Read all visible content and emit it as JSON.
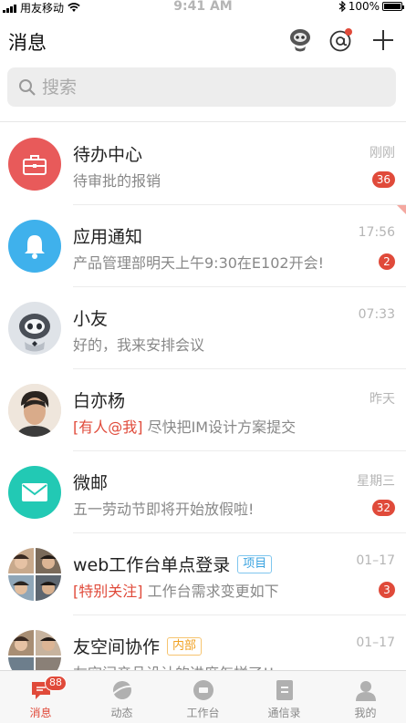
{
  "status_bar": {
    "carrier": "用友移动",
    "time": "9:41 AM",
    "battery": "100%"
  },
  "header": {
    "title": "消息"
  },
  "search": {
    "placeholder": "搜索"
  },
  "conversations": [
    {
      "name": "待办中心",
      "preview": "待审批的报销",
      "time": "刚刚",
      "badge": "36",
      "avatar": "briefcase-icon",
      "color": "#e85a5a"
    },
    {
      "name": "应用通知",
      "preview": "产品管理部明天上午9:30在E102开会!",
      "time": "17:56",
      "badge": "2",
      "avatar": "bell-icon",
      "color": "#3fb1ec"
    },
    {
      "name": "小友",
      "preview": "好的，我来安排会议",
      "time": "07:33",
      "badge": "",
      "avatar": "robot-avatar"
    },
    {
      "name": "白亦杨",
      "highlight": "[有人@我]",
      "preview": " 尽快把IM设计方案提交",
      "time": "昨天",
      "badge": "",
      "avatar": "user-photo"
    },
    {
      "name": "微邮",
      "preview": "五一劳动节即将开始放假啦!",
      "time": "星期三",
      "badge": "32",
      "avatar": "mail-icon",
      "color": "#22c9b4"
    },
    {
      "name": "web工作台单点登录",
      "tag": "项目",
      "highlight": "[特别关注]",
      "preview": " 工作台需求变更如下",
      "time": "01–17",
      "badge": "3",
      "avatar": "group-photo"
    },
    {
      "name": "友空间协作",
      "tag": "内部",
      "preview": "友空间产品设计的进度怎样了!!",
      "time": "01–17",
      "badge": "",
      "avatar": "group-photo"
    }
  ],
  "tabbar": {
    "tabs": [
      {
        "label": "消息",
        "icon": "message-icon",
        "badge": "88"
      },
      {
        "label": "动态",
        "icon": "planet-icon"
      },
      {
        "label": "工作台",
        "icon": "workbench-icon"
      },
      {
        "label": "通信录",
        "icon": "contacts-icon"
      },
      {
        "label": "我的",
        "icon": "profile-icon"
      }
    ]
  },
  "colors": {
    "accent": "#e04a3a",
    "muted": "#888888"
  }
}
